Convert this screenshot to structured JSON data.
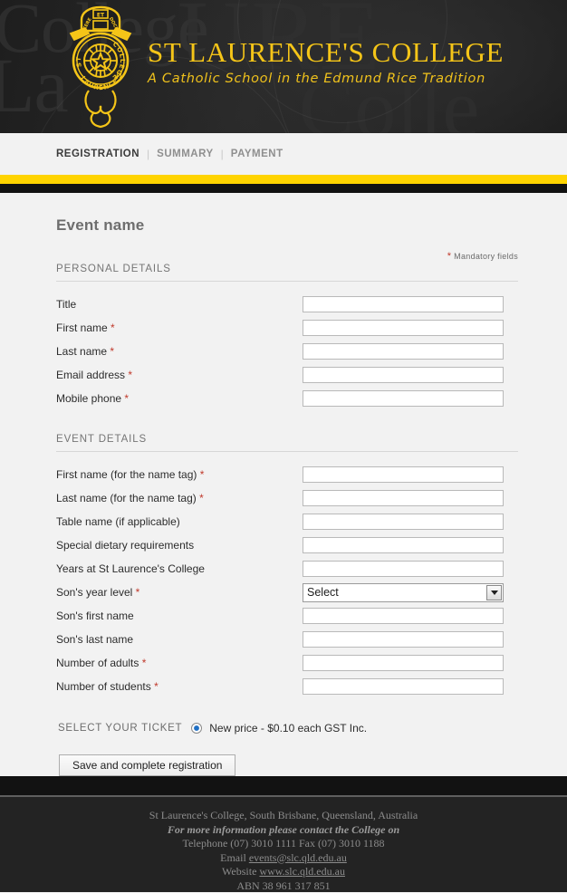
{
  "header": {
    "college_name": "ST LAURENCE'S COLLEGE",
    "tagline": "A Catholic School in the Edmund Rice Tradition",
    "crest": {
      "motto": "FACERE ET DOCERE",
      "motto_top": "ET",
      "motto_left": "FACERE",
      "motto_right": "DOCERE",
      "ring_left": "ST",
      "ring_right": "COLLEGE",
      "ring_bottom": "LAURENCE'S"
    },
    "watermark": {
      "word_a": "College",
      "word_b": "La",
      "word_c": "URE",
      "word_d": "Colle"
    }
  },
  "nav": {
    "items": [
      {
        "label": "REGISTRATION",
        "active": true
      },
      {
        "label": "SUMMARY",
        "active": false
      },
      {
        "label": "PAYMENT",
        "active": false
      }
    ],
    "separator": "|"
  },
  "colors": {
    "brand_yellow": "#ffd400",
    "brand_gold": "#f5c518",
    "bar_black": "#121212",
    "page_bg": "#f2f2f2",
    "required_red": "#c0392b",
    "radio_blue": "#1f6fc4"
  },
  "main": {
    "event_title": "Event name",
    "mandatory_star": "*",
    "mandatory_note": "Mandatory fields",
    "sections": [
      {
        "heading": "PERSONAL DETAILS",
        "fields": [
          {
            "label": "Title",
            "required": false,
            "type": "text",
            "value": ""
          },
          {
            "label": "First name",
            "required": true,
            "type": "text",
            "value": ""
          },
          {
            "label": "Last name",
            "required": true,
            "type": "text",
            "value": ""
          },
          {
            "label": "Email address",
            "required": true,
            "type": "text",
            "value": ""
          },
          {
            "label": "Mobile phone",
            "required": true,
            "type": "text",
            "value": ""
          }
        ]
      },
      {
        "heading": "EVENT DETAILS",
        "fields": [
          {
            "label": "First name (for the name tag)",
            "required": true,
            "type": "text",
            "value": ""
          },
          {
            "label": "Last name (for the name tag)",
            "required": true,
            "type": "text",
            "value": ""
          },
          {
            "label": "Table name (if applicable)",
            "required": false,
            "type": "text",
            "value": ""
          },
          {
            "label": "Special dietary requirements",
            "required": false,
            "type": "text",
            "value": ""
          },
          {
            "label": "Years at St Laurence's College",
            "required": false,
            "type": "text",
            "value": ""
          },
          {
            "label": "Son's year level",
            "required": true,
            "type": "select",
            "value": "Select"
          },
          {
            "label": "Son's first name",
            "required": false,
            "type": "text",
            "value": ""
          },
          {
            "label": "Son's last name",
            "required": false,
            "type": "text",
            "value": ""
          },
          {
            "label": "Number of adults",
            "required": true,
            "type": "text",
            "value": ""
          },
          {
            "label": "Number of students",
            "required": true,
            "type": "text",
            "value": ""
          }
        ]
      }
    ],
    "ticket": {
      "label": "SELECT YOUR TICKET",
      "option_label": "New price - $0.10 each GST Inc.",
      "selected": true
    },
    "submit_label": "Save and complete registration"
  },
  "footer": {
    "line1": "St Laurence's College, South Brisbane, Queensland, Australia",
    "line2": "For more information please contact the College on",
    "line3": "Telephone (07) 3010 1111 Fax (07) 3010 1188",
    "email_prefix": "Email ",
    "email": "events@slc.qld.edu.au",
    "website_prefix": "Website ",
    "website": "www.slc.qld.edu.au",
    "abn": "ABN 38 961 317 851"
  }
}
